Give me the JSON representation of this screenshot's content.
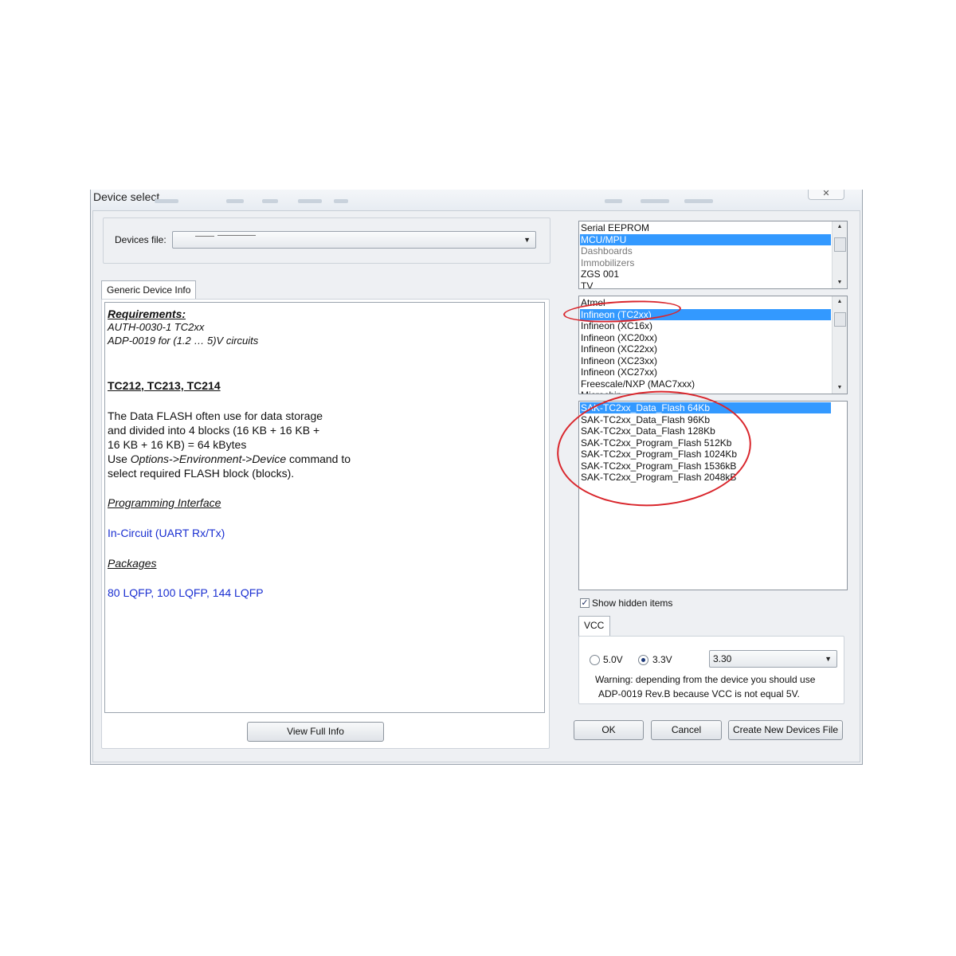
{
  "window": {
    "title": "Device select",
    "close_glyph": "✕"
  },
  "devices_file": {
    "label": "Devices file:",
    "value": ""
  },
  "info_tab": {
    "label": "Generic Device Info"
  },
  "info": {
    "requirements_heading": "Requirements:",
    "req_line1": "AUTH-0030-1 TC2xx",
    "req_line2": "ADP-0019 for (1.2 … 5)V circuits",
    "device_heading": "TC212, TC213, TC214",
    "desc_line1": "The Data FLASH often use for data storage",
    "desc_line2": "and divided into 4 blocks (16 KB + 16 KB +",
    "desc_line3": "16 KB + 16 KB) = 64 kBytes",
    "desc_line4_a": "Use ",
    "desc_line4_b": "Options->Environment->Device",
    "desc_line4_c": " command to",
    "desc_line5": "select required FLASH block (blocks).",
    "prog_heading": "Programming Interface",
    "prog_value": "In-Circuit (UART Rx/Tx)",
    "packages_heading": "Packages",
    "packages_value": "80 LQFP, 100 LQFP, 144 LQFP"
  },
  "buttons": {
    "view_full_info": "View Full Info",
    "ok": "OK",
    "cancel": "Cancel",
    "create_new": "Create New Devices File"
  },
  "category_list": {
    "items": [
      "Serial EEPROM",
      "MCU/MPU",
      "Dashboards",
      "Immobilizers",
      "ZGS 001",
      "TV"
    ],
    "selected_index": 1
  },
  "manufacturer_list": {
    "items": [
      "Atmel",
      "Infineon (TC2xx)",
      "Infineon (XC16x)",
      "Infineon (XC20xx)",
      "Infineon (XC22xx)",
      "Infineon (XC23xx)",
      "Infineon (XC27xx)",
      "Freescale/NXP (MAC7xxx)",
      "Microchip"
    ],
    "selected_index": 1
  },
  "device_list": {
    "items": [
      "SAK-TC2xx_Data_Flash 64Kb",
      "SAK-TC2xx_Data_Flash 96Kb",
      "SAK-TC2xx_Data_Flash 128Kb",
      "SAK-TC2xx_Program_Flash 512Kb",
      "SAK-TC2xx_Program_Flash 1024Kb",
      "SAK-TC2xx_Program_Flash 1536kB",
      "SAK-TC2xx_Program_Flash 2048kB"
    ],
    "selected_index": 0
  },
  "show_hidden": {
    "label": "Show hidden items",
    "checked": true
  },
  "vcc": {
    "tab_label": "VCC",
    "option_5v": "5.0V",
    "option_33v": "3.3V",
    "selected": "3.3V",
    "voltage_value": "3.30",
    "warning_line1": "Warning: depending from the device you should use",
    "warning_line2": "ADP-0019 Rev.B because VCC is not equal 5V."
  },
  "colors": {
    "selection": "#3399ff",
    "link_blue": "#1a2fd1",
    "annotation_red": "#d9262c"
  }
}
